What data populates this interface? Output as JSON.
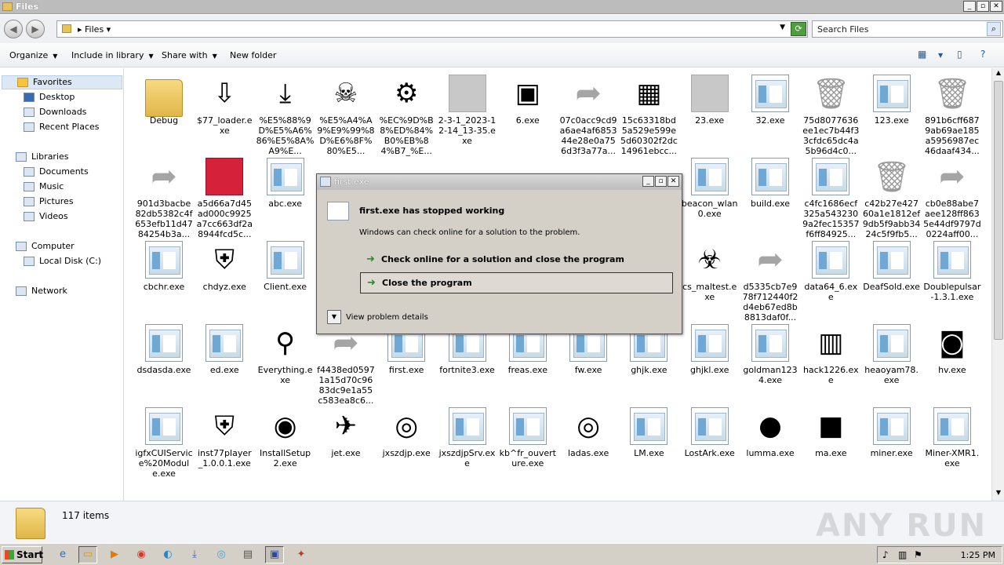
{
  "window": {
    "title": "Files"
  },
  "address": {
    "crumb": "Files",
    "search_placeholder": "Search Files"
  },
  "toolbar": {
    "organize": "Organize",
    "include": "Include in library",
    "share": "Share with",
    "new_folder": "New folder"
  },
  "nav": {
    "favorites": "Favorites",
    "desktop": "Desktop",
    "downloads": "Downloads",
    "recent": "Recent Places",
    "libraries": "Libraries",
    "documents": "Documents",
    "music": "Music",
    "pictures": "Pictures",
    "videos": "Videos",
    "computer": "Computer",
    "local_disk": "Local Disk (C:)",
    "network": "Network"
  },
  "files": [
    "Debug",
    "$77_loader.exe",
    "%E5%88%9D%E5%A6%86%E5%8A%A9%E...",
    "%E5%A4%A9%E9%99%8D%E6%8F%80%E5...",
    "%EC%9D%B8%ED%84%B0%EB%84%B7_%E...",
    "2-3-1_2023-12-14_13-35.exe",
    "6.exe",
    "07c0acc9cd9a6ae4af685344e28e0a756d3f3a77a...",
    "15c63318bd5a529e599e5d60302f2dc14961ebcc...",
    "23.exe",
    "32.exe",
    "75d8077636ee1ec7b44f33cfdc65dc4a5b96d4c0...",
    "123.exe",
    "891b6cff6879ab69ae185a5956987ec46daaf434...",
    "901d3bacbe82db5382c4f653efb11d4784254b3a...",
    "a5d66a7d45ad000c9925a7cc663df2a8944fcd5c...",
    "abc.exe",
    "",
    "",
    "",
    "",
    "",
    "",
    "beacon_wlan0.exe",
    "build.exe",
    "c4fc1686ecf325a5432309a2fec15357f6ff84925...",
    "c42b27e42760a1e1812ef9db5f9abb3424c5f9fb5...",
    "cb0e88abe7aee128ff8635e44df9797d0224aff00...",
    "cbchr.exe",
    "chdyz.exe",
    "Client.exe",
    "",
    "",
    "",
    "",
    "",
    "",
    "cs_maltest.exe",
    "d5335cb7e978f712440f2d4eb67ed8b8813daf0f...",
    "data64_6.exe",
    "DeafSold.exe",
    "Doublepulsar-1.3.1.exe",
    "dsdasda.exe",
    "ed.exe",
    "Everything.exe",
    "f4438ed05971a15d70c9683dc9e1a55c583ea8c6...",
    "first.exe",
    "fortnite3.exe",
    "freas.exe",
    "fw.exe",
    "ghjk.exe",
    "ghjkl.exe",
    "goldman1234.exe",
    "hack1226.exe",
    "heaoyam78.exe",
    "hv.exe",
    "igfxCUIService%20Module.exe",
    "inst77player_1.0.0.1.exe",
    "InstallSetup2.exe",
    "jet.exe",
    "jxszdjp.exe",
    "jxszdjpSrv.exe",
    "kb^fr_ouverture.exe",
    "ladas.exe",
    "LM.exe",
    "LostArk.exe",
    "lumma.exe",
    "ma.exe",
    "miner.exe",
    "Miner-XMR1.exe"
  ],
  "icons": [
    "folder-icon",
    "installer-icon",
    "download-icon",
    "skull-icon",
    "gear-globe-icon",
    "blurred-icon",
    "terminal-icon",
    "shortcut-arrow-icon",
    "winrar-icon",
    "blurred-icon",
    "exe-icon",
    "recycle-bin-icon",
    "exe-icon",
    "recycle-bin-icon",
    "shortcut-arrow-icon",
    "red-app-icon",
    "exe-icon",
    "",
    "",
    "",
    "",
    "",
    "",
    "exe-icon",
    "exe-icon",
    "exe-icon",
    "recycle-bin-icon",
    "shortcut-arrow-icon",
    "exe-icon",
    "shield-app-icon",
    "exe-icon",
    "",
    "",
    "",
    "",
    "",
    "",
    "biohazard-icon",
    "shortcut-arrow-icon",
    "exe-icon",
    "exe-icon",
    "exe-icon",
    "exe-icon",
    "exe-icon",
    "magnifier-icon",
    "shortcut-arrow-icon",
    "exe-icon",
    "exe-icon",
    "exe-icon",
    "exe-icon",
    "exe-icon",
    "exe-icon",
    "exe-icon",
    "server-shield-icon",
    "exe-icon",
    "camera-app-icon",
    "window-app-icon",
    "shield-app-icon",
    "wifi-app-icon",
    "jet-app-icon",
    "disc-icon",
    "exe-icon",
    "exe-icon",
    "target-icon",
    "exe-icon",
    "exe-icon",
    "green-circle-icon",
    "box-icon",
    "exe-icon",
    "exe-icon"
  ],
  "dialog": {
    "title": "first.exe",
    "heading": "first.exe has stopped working",
    "subtext": "Windows can check online for a solution to the problem.",
    "option1": "Check online for a solution and close the program",
    "option2": "Close the program",
    "details": "View problem details"
  },
  "status": {
    "count": "117 items",
    "watermark": "ANY RUN"
  },
  "taskbar": {
    "start": "Start",
    "clock": "1:25 PM"
  }
}
